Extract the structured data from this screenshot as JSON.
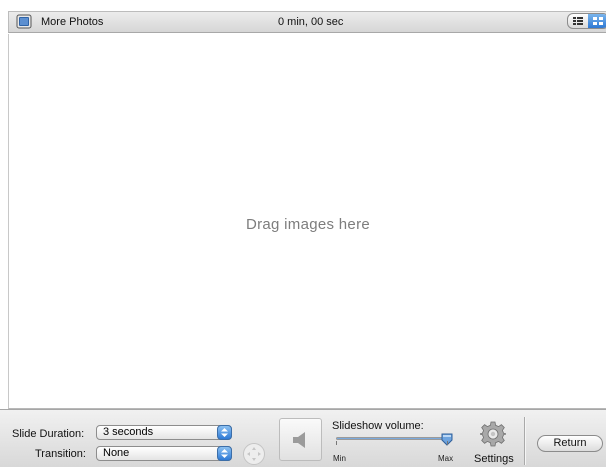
{
  "header": {
    "album_title": "More Photos",
    "duration_summary": "0 min, 00 sec",
    "view_mode": "grid"
  },
  "main": {
    "drop_hint": "Drag images here"
  },
  "toolbar": {
    "slide_duration_label": "Slide Duration:",
    "slide_duration_value": "3 seconds",
    "transition_label": "Transition:",
    "transition_value": "None",
    "volume_label": "Slideshow volume:",
    "volume_min_label": "Min",
    "volume_max_label": "Max",
    "volume_level": 1.0,
    "settings_label": "Settings",
    "return_label": "Return"
  },
  "colors": {
    "accent": "#2e7ad6",
    "drop_hint_text": "#7d7d7d"
  },
  "icons": [
    "album-icon",
    "list-view-icon",
    "grid-view-icon",
    "speaker-icon",
    "gear-icon",
    "navigation-icon"
  ]
}
